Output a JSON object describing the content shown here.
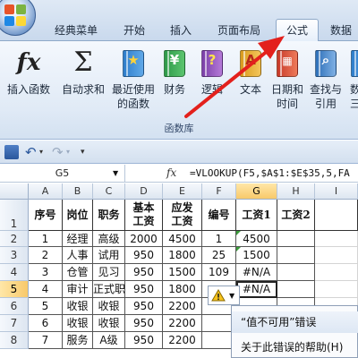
{
  "tabs": [
    {
      "label": "经典菜单"
    },
    {
      "label": "开始"
    },
    {
      "label": "插入"
    },
    {
      "label": "页面布局"
    },
    {
      "label": "公式"
    },
    {
      "label": "数据"
    }
  ],
  "ribbon": {
    "buttons": [
      {
        "line1": "插入函数",
        "line2": "",
        "icon": "fx-icon"
      },
      {
        "line1": "自动求和",
        "line2": "",
        "icon": "sigma-icon"
      },
      {
        "line1": "最近使用",
        "line2": "的函数",
        "icon": "star-book-icon"
      },
      {
        "line1": "财务",
        "line2": "",
        "icon": "money-book-icon"
      },
      {
        "line1": "逻辑",
        "line2": "",
        "icon": "question-book-icon"
      },
      {
        "line1": "文本",
        "line2": "",
        "icon": "text-book-icon"
      },
      {
        "line1": "日期和",
        "line2": "时间",
        "icon": "calendar-book-icon"
      },
      {
        "line1": "查找与",
        "line2": "引用",
        "icon": "magnifier-book-icon"
      },
      {
        "line1": "数",
        "line2": "三",
        "icon": "math-book-icon"
      }
    ],
    "group_label": "函数库"
  },
  "formula_bar": {
    "name_box": "G5",
    "fx_label": "fx",
    "formula": "=VLOOKUP(F5,$A$1:$E$35,5,FA"
  },
  "grid": {
    "columns": [
      "A",
      "B",
      "C",
      "D",
      "E",
      "F",
      "G",
      "H",
      "I"
    ],
    "rows": [
      "1",
      "2",
      "3",
      "4",
      "5",
      "6",
      "7",
      "8"
    ],
    "header_row": [
      "序号",
      "岗位",
      "职务",
      "基本工资",
      "应发工资",
      "编号",
      "工资1",
      "工资2",
      ""
    ],
    "data": [
      [
        "1",
        "经理",
        "高级",
        "2000",
        "4500",
        "1",
        "4500",
        "",
        ""
      ],
      [
        "2",
        "人事",
        "试用",
        "950",
        "1800",
        "25",
        "1500",
        "",
        ""
      ],
      [
        "3",
        "仓管",
        "见习",
        "950",
        "1500",
        "109",
        "#N/A",
        "",
        ""
      ],
      [
        "4",
        "审计",
        "正式职",
        "950",
        "1800",
        "",
        "#N/A",
        "",
        ""
      ],
      [
        "5",
        "收银",
        "收银",
        "950",
        "2200",
        "",
        "",
        "",
        ""
      ],
      [
        "6",
        "收银",
        "收银",
        "950",
        "2200",
        "",
        "",
        "",
        ""
      ],
      [
        "7",
        "服务",
        "A级",
        "950",
        "2200",
        "",
        "",
        "",
        ""
      ]
    ]
  },
  "error_menu": {
    "title": "“值不可用”错误",
    "help_link": "关于此错误的帮助(H)"
  },
  "colors": {
    "accent_arrow": "#e3201c",
    "selection": "#f8c96a",
    "error_indicator": "#3a9b3a"
  }
}
